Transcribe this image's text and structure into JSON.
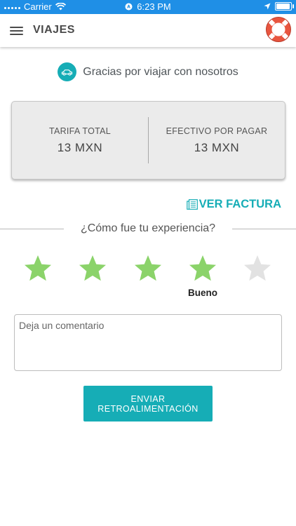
{
  "status_bar": {
    "carrier": "Carrier",
    "time": "6:23 PM"
  },
  "header": {
    "title": "VIAJES",
    "menu_icon": "hamburger-menu-icon",
    "help_icon": "lifebuoy-icon"
  },
  "thanks": {
    "icon": "car-icon",
    "text": "Gracias por viajar con nosotros"
  },
  "fare": {
    "total_label": "TARIFA TOTAL",
    "total_value": "13 MXN",
    "cash_label": "EFECTIVO POR PAGAR",
    "cash_value": "13 MXN"
  },
  "invoice": {
    "icon": "document-icon",
    "label": "VER FACTURA"
  },
  "experience": {
    "question": "¿Cómo fue tu experiencia?",
    "rating": 4,
    "max_rating": 5,
    "rating_label": "Bueno",
    "comment_placeholder": "Deja un comentario",
    "submit_label": "ENVIAR RETROALIMENTACIÓN"
  },
  "colors": {
    "accent": "#16adb6",
    "status_bar": "#1f8fe6",
    "star_active": "#8bd36a",
    "star_inactive": "#e2e2e2",
    "help_ring": "#e8553f"
  }
}
